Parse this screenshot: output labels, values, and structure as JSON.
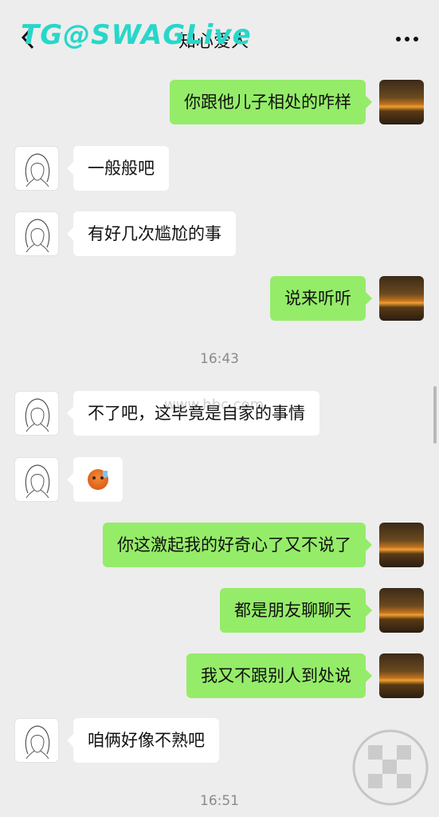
{
  "header": {
    "back_icon": "chevron-left-icon",
    "title": "知心爱人",
    "more_icon": "more-dots-icon",
    "watermark": "TG@SWAGLive"
  },
  "middle_watermark": "www.hbc.com",
  "messages": [
    {
      "side": "right",
      "type": "text",
      "text": "你跟他儿子相处的咋样"
    },
    {
      "side": "left",
      "type": "text",
      "text": "一般般吧"
    },
    {
      "side": "left",
      "type": "text",
      "text": "有好几次尴尬的事"
    },
    {
      "side": "right",
      "type": "text",
      "text": "说来听听"
    },
    {
      "type": "timestamp",
      "text": "16:43"
    },
    {
      "side": "left",
      "type": "text",
      "text": "不了吧，这毕竟是自家的事情"
    },
    {
      "side": "left",
      "type": "emoji",
      "icon": "sweat-face-emoji"
    },
    {
      "side": "right",
      "type": "text",
      "text": "你这激起我的好奇心了又不说了"
    },
    {
      "side": "right",
      "type": "text",
      "text": "都是朋友聊聊天"
    },
    {
      "side": "right",
      "type": "text",
      "text": "我又不跟别人到处说"
    },
    {
      "side": "left",
      "type": "text",
      "text": "咱俩好像不熟吧"
    },
    {
      "type": "timestamp",
      "text": "16:51"
    }
  ],
  "colors": {
    "background": "#ededed",
    "right_bubble": "#95ec69",
    "left_bubble": "#ffffff",
    "watermark": "#27d7c9"
  }
}
